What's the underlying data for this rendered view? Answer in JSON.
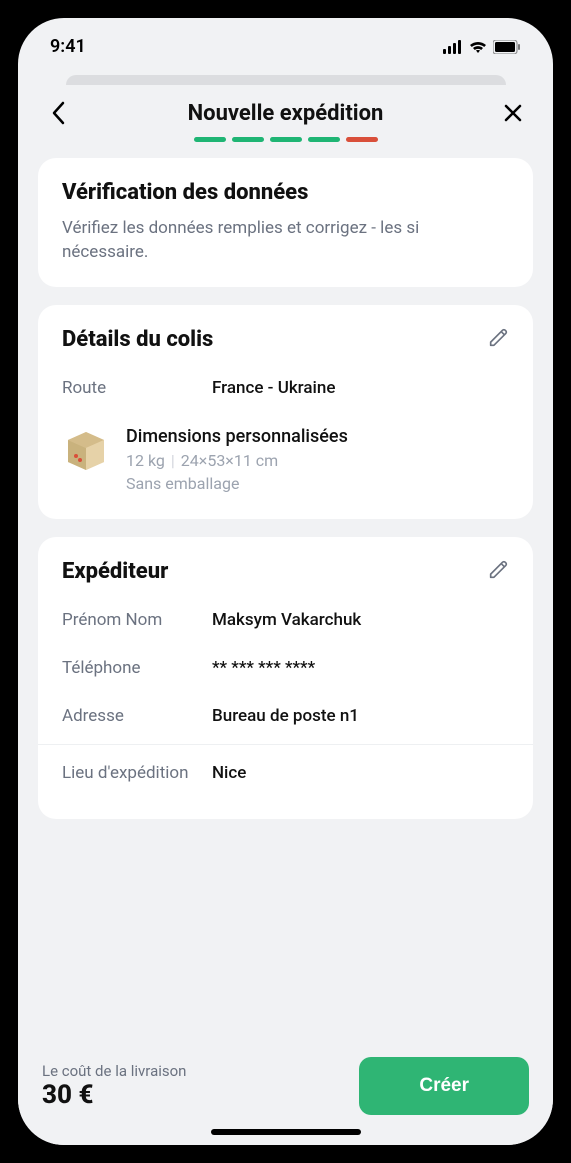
{
  "statusBar": {
    "time": "9:41"
  },
  "header": {
    "title": "Nouvelle expédition"
  },
  "verification": {
    "title": "Vérification des données",
    "desc": "Vérifiez les données remplies et corrigez - les si nécessaire."
  },
  "details": {
    "title": "Détails du colis",
    "routeLabel": "Route",
    "routeValue": "France - Ukraine",
    "packageTitle": "Dimensions personnalisées",
    "weight": "12 kg",
    "dimensions": "24×53×11 cm",
    "packaging": "Sans emballage"
  },
  "sender": {
    "title": "Expéditeur",
    "nameLabel": "Prénom Nom",
    "nameValue": "Maksym Vakarchuk",
    "phoneLabel": "Téléphone",
    "phoneValue": "** *** *** ****",
    "addressLabel": "Adresse",
    "addressValue": "Bureau de poste n1",
    "locationLabel": "Lieu d'expédition",
    "locationValue": "Nice"
  },
  "footer": {
    "costLabel": "Le coût de la livraison",
    "costValue": "30 €",
    "createLabel": "Créer"
  }
}
